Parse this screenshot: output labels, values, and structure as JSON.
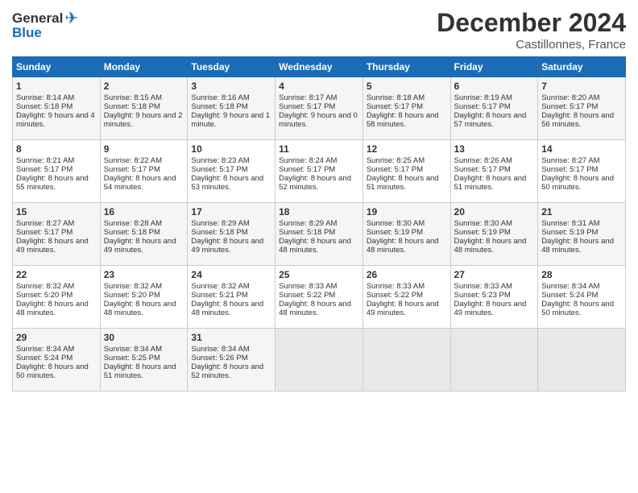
{
  "header": {
    "logo_general": "General",
    "logo_blue": "Blue",
    "title": "December 2024",
    "subtitle": "Castillonnes, France"
  },
  "days_of_week": [
    "Sunday",
    "Monday",
    "Tuesday",
    "Wednesday",
    "Thursday",
    "Friday",
    "Saturday"
  ],
  "weeks": [
    [
      {
        "day": "1",
        "sunrise": "Sunrise: 8:14 AM",
        "sunset": "Sunset: 5:18 PM",
        "daylight": "Daylight: 9 hours and 4 minutes."
      },
      {
        "day": "2",
        "sunrise": "Sunrise: 8:15 AM",
        "sunset": "Sunset: 5:18 PM",
        "daylight": "Daylight: 9 hours and 2 minutes."
      },
      {
        "day": "3",
        "sunrise": "Sunrise: 8:16 AM",
        "sunset": "Sunset: 5:18 PM",
        "daylight": "Daylight: 9 hours and 1 minute."
      },
      {
        "day": "4",
        "sunrise": "Sunrise: 8:17 AM",
        "sunset": "Sunset: 5:17 PM",
        "daylight": "Daylight: 9 hours and 0 minutes."
      },
      {
        "day": "5",
        "sunrise": "Sunrise: 8:18 AM",
        "sunset": "Sunset: 5:17 PM",
        "daylight": "Daylight: 8 hours and 58 minutes."
      },
      {
        "day": "6",
        "sunrise": "Sunrise: 8:19 AM",
        "sunset": "Sunset: 5:17 PM",
        "daylight": "Daylight: 8 hours and 57 minutes."
      },
      {
        "day": "7",
        "sunrise": "Sunrise: 8:20 AM",
        "sunset": "Sunset: 5:17 PM",
        "daylight": "Daylight: 8 hours and 56 minutes."
      }
    ],
    [
      {
        "day": "8",
        "sunrise": "Sunrise: 8:21 AM",
        "sunset": "Sunset: 5:17 PM",
        "daylight": "Daylight: 8 hours and 55 minutes."
      },
      {
        "day": "9",
        "sunrise": "Sunrise: 8:22 AM",
        "sunset": "Sunset: 5:17 PM",
        "daylight": "Daylight: 8 hours and 54 minutes."
      },
      {
        "day": "10",
        "sunrise": "Sunrise: 8:23 AM",
        "sunset": "Sunset: 5:17 PM",
        "daylight": "Daylight: 8 hours and 53 minutes."
      },
      {
        "day": "11",
        "sunrise": "Sunrise: 8:24 AM",
        "sunset": "Sunset: 5:17 PM",
        "daylight": "Daylight: 8 hours and 52 minutes."
      },
      {
        "day": "12",
        "sunrise": "Sunrise: 8:25 AM",
        "sunset": "Sunset: 5:17 PM",
        "daylight": "Daylight: 8 hours and 51 minutes."
      },
      {
        "day": "13",
        "sunrise": "Sunrise: 8:26 AM",
        "sunset": "Sunset: 5:17 PM",
        "daylight": "Daylight: 8 hours and 51 minutes."
      },
      {
        "day": "14",
        "sunrise": "Sunrise: 8:27 AM",
        "sunset": "Sunset: 5:17 PM",
        "daylight": "Daylight: 8 hours and 50 minutes."
      }
    ],
    [
      {
        "day": "15",
        "sunrise": "Sunrise: 8:27 AM",
        "sunset": "Sunset: 5:17 PM",
        "daylight": "Daylight: 8 hours and 49 minutes."
      },
      {
        "day": "16",
        "sunrise": "Sunrise: 8:28 AM",
        "sunset": "Sunset: 5:18 PM",
        "daylight": "Daylight: 8 hours and 49 minutes."
      },
      {
        "day": "17",
        "sunrise": "Sunrise: 8:29 AM",
        "sunset": "Sunset: 5:18 PM",
        "daylight": "Daylight: 8 hours and 49 minutes."
      },
      {
        "day": "18",
        "sunrise": "Sunrise: 8:29 AM",
        "sunset": "Sunset: 5:18 PM",
        "daylight": "Daylight: 8 hours and 48 minutes."
      },
      {
        "day": "19",
        "sunrise": "Sunrise: 8:30 AM",
        "sunset": "Sunset: 5:19 PM",
        "daylight": "Daylight: 8 hours and 48 minutes."
      },
      {
        "day": "20",
        "sunrise": "Sunrise: 8:30 AM",
        "sunset": "Sunset: 5:19 PM",
        "daylight": "Daylight: 8 hours and 48 minutes."
      },
      {
        "day": "21",
        "sunrise": "Sunrise: 8:31 AM",
        "sunset": "Sunset: 5:19 PM",
        "daylight": "Daylight: 8 hours and 48 minutes."
      }
    ],
    [
      {
        "day": "22",
        "sunrise": "Sunrise: 8:32 AM",
        "sunset": "Sunset: 5:20 PM",
        "daylight": "Daylight: 8 hours and 48 minutes."
      },
      {
        "day": "23",
        "sunrise": "Sunrise: 8:32 AM",
        "sunset": "Sunset: 5:20 PM",
        "daylight": "Daylight: 8 hours and 48 minutes."
      },
      {
        "day": "24",
        "sunrise": "Sunrise: 8:32 AM",
        "sunset": "Sunset: 5:21 PM",
        "daylight": "Daylight: 8 hours and 48 minutes."
      },
      {
        "day": "25",
        "sunrise": "Sunrise: 8:33 AM",
        "sunset": "Sunset: 5:22 PM",
        "daylight": "Daylight: 8 hours and 48 minutes."
      },
      {
        "day": "26",
        "sunrise": "Sunrise: 8:33 AM",
        "sunset": "Sunset: 5:22 PM",
        "daylight": "Daylight: 8 hours and 49 minutes."
      },
      {
        "day": "27",
        "sunrise": "Sunrise: 8:33 AM",
        "sunset": "Sunset: 5:23 PM",
        "daylight": "Daylight: 8 hours and 49 minutes."
      },
      {
        "day": "28",
        "sunrise": "Sunrise: 8:34 AM",
        "sunset": "Sunset: 5:24 PM",
        "daylight": "Daylight: 8 hours and 50 minutes."
      }
    ],
    [
      {
        "day": "29",
        "sunrise": "Sunrise: 8:34 AM",
        "sunset": "Sunset: 5:24 PM",
        "daylight": "Daylight: 8 hours and 50 minutes."
      },
      {
        "day": "30",
        "sunrise": "Sunrise: 8:34 AM",
        "sunset": "Sunset: 5:25 PM",
        "daylight": "Daylight: 8 hours and 51 minutes."
      },
      {
        "day": "31",
        "sunrise": "Sunrise: 8:34 AM",
        "sunset": "Sunset: 5:26 PM",
        "daylight": "Daylight: 8 hours and 52 minutes."
      },
      null,
      null,
      null,
      null
    ]
  ]
}
